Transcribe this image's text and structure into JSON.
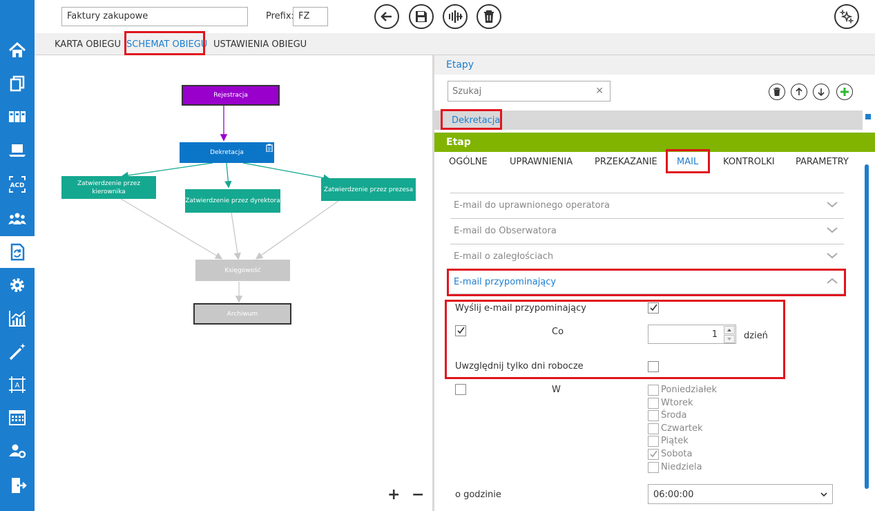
{
  "header": {
    "title_value": "Faktury zakupowe",
    "prefix_label": "Prefix:",
    "prefix_value": "FZ"
  },
  "main_tabs": [
    {
      "label": "KARTA OBIEGU"
    },
    {
      "label": "SCHEMAT OBIEGU"
    },
    {
      "label": "USTAWIENIA OBIEGU"
    }
  ],
  "flow_nodes": {
    "rejestracja": "Rejestracja",
    "dekretacja": "Dekretacja",
    "zatw_kierownika": "Zatwierdzenie przez kierownika",
    "zatw_dyrektora": "Zatwierdzenie przez dyrektora",
    "zatw_prezesa": "Zatwierdzenie przez prezesa",
    "ksiegowosc": "Księgowość",
    "archiwum": "Archiwum"
  },
  "zoom": {
    "plus": "+",
    "minus": "−"
  },
  "etapy": {
    "title": "Etapy",
    "search_placeholder": "Szukaj",
    "selected_stage": "Dekretacja"
  },
  "etap": {
    "title": "Etap",
    "tabs": [
      {
        "label": "OGÓLNE"
      },
      {
        "label": "UPRAWNIENIA"
      },
      {
        "label": "PRZEKAZANIE"
      },
      {
        "label": "MAIL"
      },
      {
        "label": "KONTROLKI"
      },
      {
        "label": "PARAMETRY"
      }
    ]
  },
  "accordion": [
    {
      "label": "E-mail do uprawnionego operatora"
    },
    {
      "label": "E-mail do Obserwatora"
    },
    {
      "label": "E-mail o zaległościach"
    },
    {
      "label": "E-mail przypominający"
    }
  ],
  "reminder": {
    "send_label": "Wyślij e-mail przypominający",
    "co_label": "Co",
    "co_value": "1",
    "co_unit": "dzień",
    "workdays_label": "Uwzględnij tylko dni robocze",
    "w_label": "W",
    "days": [
      {
        "label": "Poniedziałek",
        "checked": false
      },
      {
        "label": "Wtorek",
        "checked": false
      },
      {
        "label": "Środa",
        "checked": false
      },
      {
        "label": "Czwartek",
        "checked": false
      },
      {
        "label": "Piątek",
        "checked": false
      },
      {
        "label": "Sobota",
        "checked": true
      },
      {
        "label": "Niedziela",
        "checked": false
      }
    ],
    "time_label": "o godzinie",
    "time_value": "06:00:00"
  },
  "colors": {
    "nav_blue": "#1c7ecf",
    "accent_green": "#80b400",
    "highlight_red": "#e0141e",
    "node_purple": "#9900cc",
    "node_blue": "#0b76c8",
    "node_teal": "#15a890",
    "node_gray": "#c8c8c8"
  },
  "icons": {
    "nav": [
      "home-icon",
      "documents-icon",
      "binders-icon",
      "laptop-icon",
      "ocr-icon",
      "users-icon",
      "workflow-icon",
      "gear-icon",
      "chart-icon",
      "magic-wand-icon",
      "template-icon",
      "calendar-icon",
      "user-settings-icon",
      "logout-icon"
    ],
    "toolbar": [
      "back-icon",
      "save-icon",
      "split-icon",
      "trash-icon",
      "sparkle-icon"
    ]
  }
}
